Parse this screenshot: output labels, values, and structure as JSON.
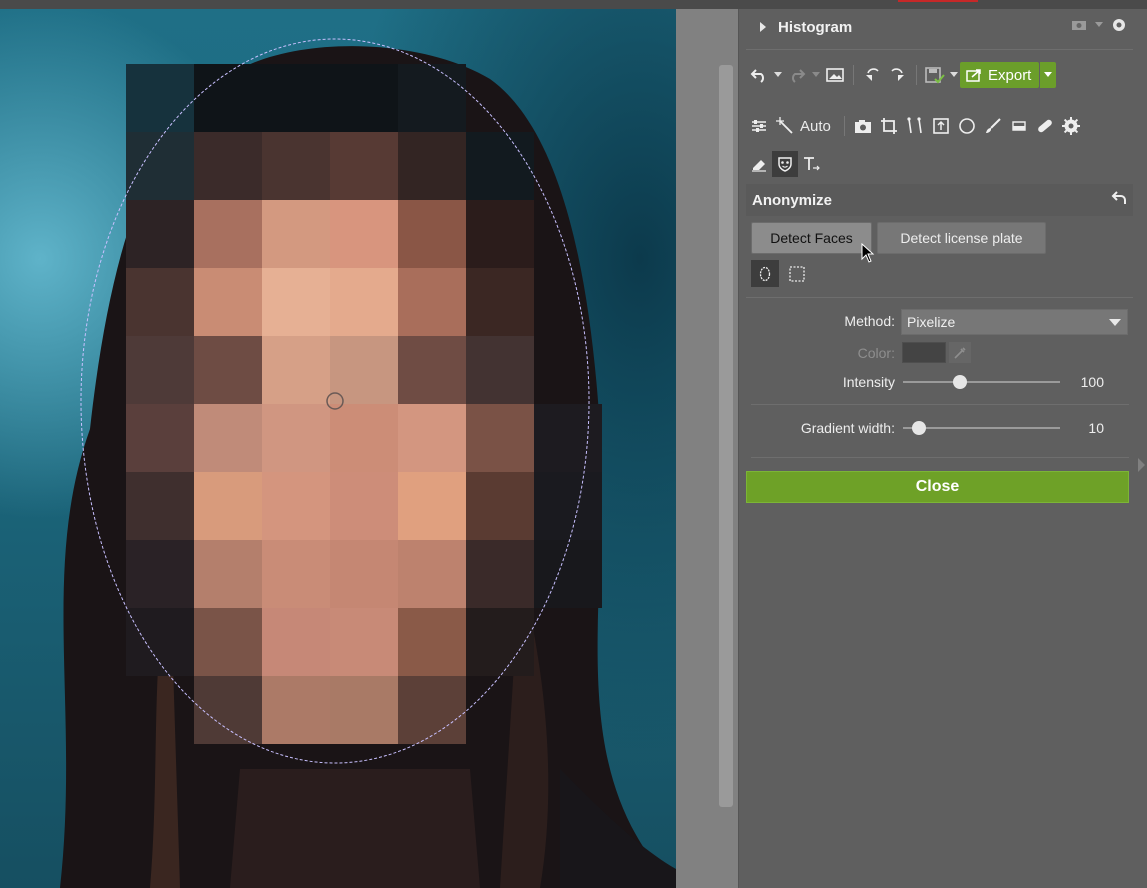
{
  "window": {
    "accent_color": "#c62828"
  },
  "photo": {
    "description_icon": "image-icon",
    "pixel_colors": [
      [
        "",
        "#16323d",
        "#0f1418",
        "#0f1418",
        "#0f1418",
        "#141a1f",
        "",
        ""
      ],
      [
        "",
        "#1f2e35",
        "#3b2b2a",
        "#4a3430",
        "#573a34",
        "#332523",
        "#121a1f",
        ""
      ],
      [
        "",
        "#2d2325",
        "#a8705f",
        "#d39980",
        "#d8957e",
        "#8a5646",
        "#2b1c1b",
        ""
      ],
      [
        "",
        "#4a3430",
        "#c98c74",
        "#e6b094",
        "#e4aa8d",
        "#a96e5b",
        "#3b2723",
        ""
      ],
      [
        "",
        "#4e3a38",
        "#6e4c44",
        "#d6a087",
        "#c79680",
        "#6f4c44",
        "#433332",
        ""
      ],
      [
        "",
        "#5a3f3c",
        "#c08b79",
        "#d09681",
        "#cc8d77",
        "#d39680",
        "#7a5246",
        "#1d1b20"
      ],
      [
        "",
        "#3f2f2e",
        "#d89b7c",
        "#d4957e",
        "#cd8d79",
        "#e0a07f",
        "#5a3b32",
        "#1a1a1f"
      ],
      [
        "",
        "#2a2226",
        "#b47f6c",
        "#c98c77",
        "#c58773",
        "#bd826e",
        "#3a2a29",
        "#18181c"
      ],
      [
        "",
        "#1f1b1f",
        "#7a5448",
        "#c68877",
        "#c88a77",
        "#8a5a48",
        "#231c1c",
        ""
      ],
      [
        "",
        "",
        "#4f3a36",
        "#ac7a67",
        "#a97a66",
        "#5c4038",
        "",
        ""
      ],
      [
        "",
        "",
        "",
        "",
        "",
        "",
        "",
        ""
      ]
    ]
  },
  "histogram": {
    "title": "Histogram"
  },
  "toolbar": {
    "export_label": "Export",
    "auto_label": "Auto",
    "export_color": "#6b9e2a"
  },
  "anonymize": {
    "title": "Anonymize",
    "detect_faces": "Detect Faces",
    "detect_plate": "Detect license plate",
    "method_label": "Method:",
    "method_value": "Pixelize",
    "color_label": "Color:",
    "intensity_label": "Intensity",
    "intensity_value": "100",
    "intensity_fraction": 0.36,
    "gradient_label": "Gradient width:",
    "gradient_value": "10",
    "gradient_fraction": 0.1,
    "close_label": "Close",
    "close_color": "#6ea127"
  }
}
